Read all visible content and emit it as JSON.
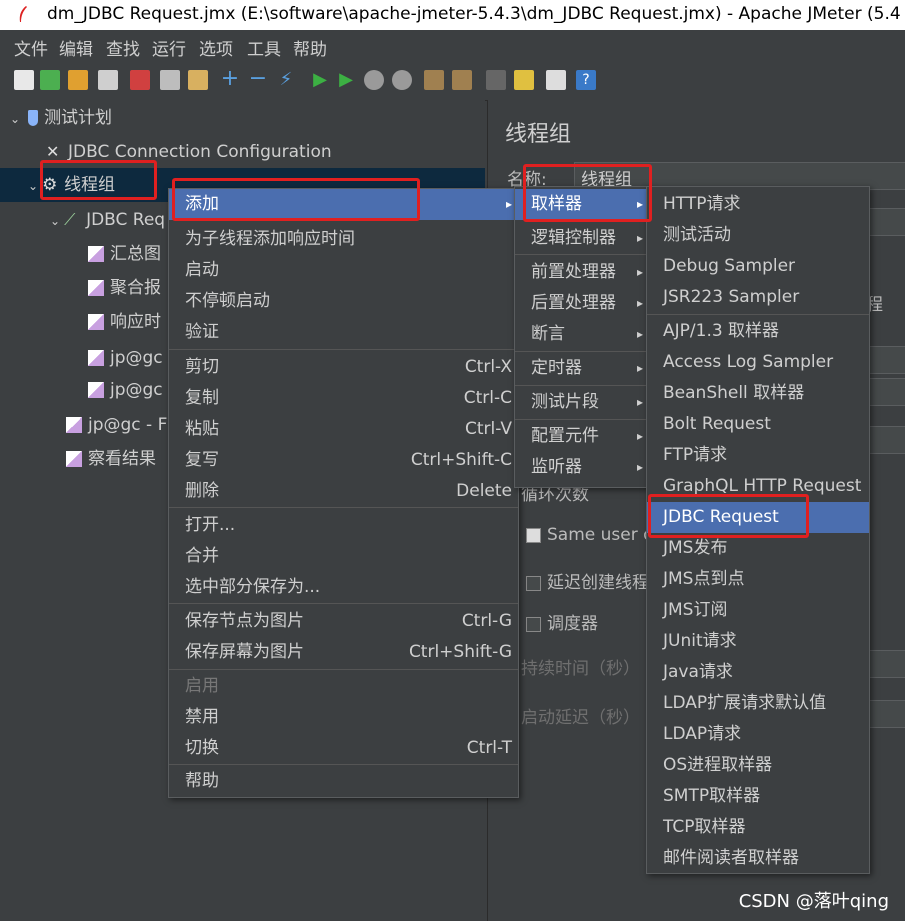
{
  "window": {
    "title": "dm_JDBC Request.jmx (E:\\software\\apache-jmeter-5.4.3\\dm_JDBC Request.jmx) - Apache JMeter (5.4"
  },
  "menubar": [
    "文件",
    "编辑",
    "查找",
    "运行",
    "选项",
    "工具",
    "帮助"
  ],
  "tree": {
    "test_plan": "测试计划",
    "jdbc_config": "JDBC Connection Configuration",
    "thread_group": "线程组",
    "jdbc_request": "JDBC Req",
    "children": [
      "汇总图",
      "聚合报",
      "响应时",
      "jp@gc",
      "jp@gc"
    ],
    "jp_gc_f": "jp@gc - F",
    "view_results": "察看结果"
  },
  "right": {
    "heading": "线程组",
    "name_label": "名称:",
    "name_value": "线程组",
    "loop_count": "循环次数",
    "same_user": "Same user o",
    "delay_create": "延迟创建线程",
    "scheduler": "调度器",
    "duration": "持续时间（秒）",
    "startup_delay": "启动延迟（秒）",
    "process_partial": "程"
  },
  "context_menu": {
    "items": [
      {
        "label": "添加",
        "arrow": "▸",
        "highlight": true
      },
      {
        "label": "为子线程添加响应时间"
      },
      {
        "label": "启动"
      },
      {
        "label": "不停顿启动"
      },
      {
        "label": "验证"
      },
      {
        "label": "剪切",
        "shortcut": "Ctrl-X"
      },
      {
        "label": "复制",
        "shortcut": "Ctrl-C"
      },
      {
        "label": "粘贴",
        "shortcut": "Ctrl-V"
      },
      {
        "label": "复写",
        "shortcut": "Ctrl+Shift-C"
      },
      {
        "label": "删除",
        "shortcut": "Delete"
      },
      {
        "label": "打开..."
      },
      {
        "label": "合并"
      },
      {
        "label": "选中部分保存为..."
      },
      {
        "label": "保存节点为图片",
        "shortcut": "Ctrl-G"
      },
      {
        "label": "保存屏幕为图片",
        "shortcut": "Ctrl+Shift-G"
      },
      {
        "label": "启用",
        "disabled": true
      },
      {
        "label": "禁用"
      },
      {
        "label": "切换",
        "shortcut": "Ctrl-T"
      },
      {
        "label": "帮助"
      }
    ]
  },
  "add_submenu": {
    "items": [
      "取样器",
      "逻辑控制器",
      "前置处理器",
      "后置处理器",
      "断言",
      "定时器",
      "测试片段",
      "配置元件",
      "监听器"
    ]
  },
  "sampler_submenu": {
    "items": [
      "HTTP请求",
      "测试活动",
      "Debug Sampler",
      "JSR223 Sampler",
      "AJP/1.3 取样器",
      "Access Log Sampler",
      "BeanShell 取样器",
      "Bolt Request",
      "FTP请求",
      "GraphQL HTTP Request",
      "JDBC Request",
      "JMS发布",
      "JMS点到点",
      "JMS订阅",
      "JUnit请求",
      "Java请求",
      "LDAP扩展请求默认值",
      "LDAP请求",
      "OS进程取样器",
      "SMTP取样器",
      "TCP取样器",
      "邮件阅读者取样器"
    ],
    "selected": "JDBC Request"
  },
  "watermark": "CSDN @落叶qing",
  "colors": {
    "highlight": "#4b6eaf",
    "annotation": "#e02020",
    "bg": "#3c3f41"
  }
}
